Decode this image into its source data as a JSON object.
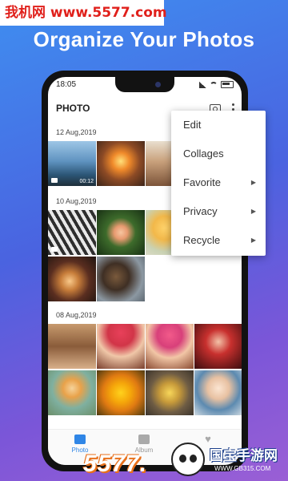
{
  "watermark_top": "我机网 www.5577.com",
  "headline": "Organize Your Photos",
  "status": {
    "time": "18:05"
  },
  "app": {
    "title": "PHOTO"
  },
  "sections": [
    {
      "date": "12 Aug,2019",
      "duration": "00:12"
    },
    {
      "date": "10 Aug,2019"
    },
    {
      "date": "08 Aug,2019"
    }
  ],
  "menu": {
    "items": [
      {
        "label": "Edit",
        "has_submenu": false
      },
      {
        "label": "Collages",
        "has_submenu": false
      },
      {
        "label": "Favorite",
        "has_submenu": true
      },
      {
        "label": "Privacy",
        "has_submenu": true
      },
      {
        "label": "Recycle",
        "has_submenu": true
      }
    ],
    "arrow": "▶"
  },
  "nav": {
    "photo": "Photo",
    "album": "Album"
  },
  "watermark_bottom_left": "5577.",
  "watermark_bottom_right": {
    "title": "国宝手游网",
    "url": "WWW.GB315.COM"
  },
  "colors": {
    "accent": "#2f86e6",
    "headline": "#ffffff",
    "watermark_red": "#e0201b"
  }
}
